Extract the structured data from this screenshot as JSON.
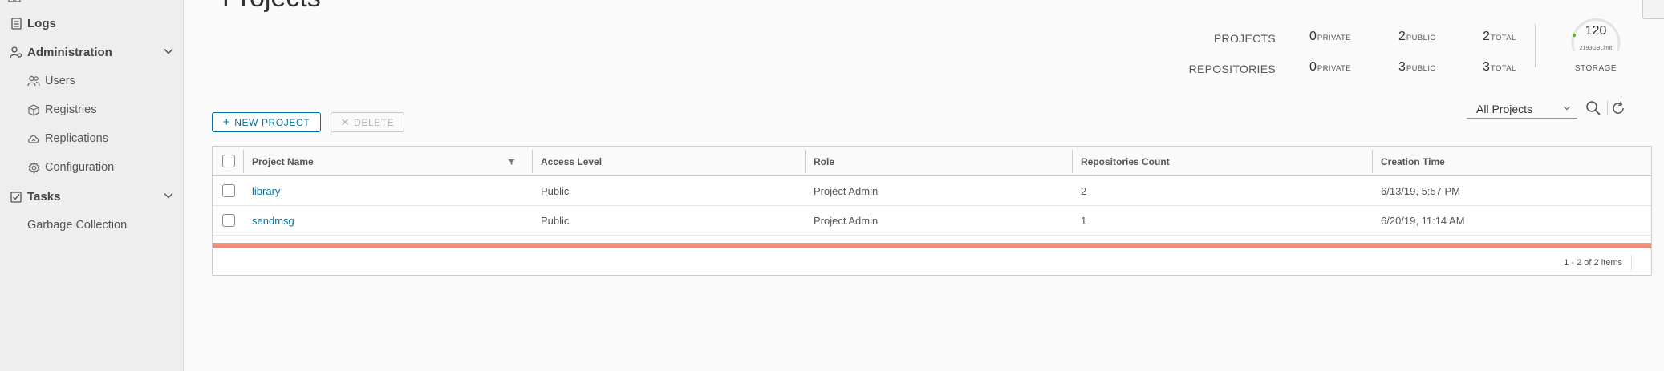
{
  "sidebar": {
    "items": [
      {
        "label": "Logs",
        "icon": "logs-icon",
        "kind": "top"
      },
      {
        "label": "Administration",
        "icon": "administration-icon",
        "kind": "top",
        "expanded": true
      },
      {
        "label": "Users",
        "icon": "users-icon",
        "kind": "sub"
      },
      {
        "label": "Registries",
        "icon": "registries-icon",
        "kind": "sub"
      },
      {
        "label": "Replications",
        "icon": "replications-icon",
        "kind": "sub"
      },
      {
        "label": "Configuration",
        "icon": "configuration-icon",
        "kind": "sub"
      },
      {
        "label": "Tasks",
        "icon": "tasks-icon",
        "kind": "top",
        "expanded": true
      },
      {
        "label": "Garbage Collection",
        "kind": "plain"
      }
    ]
  },
  "page": {
    "title": "Projects"
  },
  "stats": {
    "projects_label": "PROJECTS",
    "repositories_label": "REPOSITORIES",
    "projects": {
      "private": "0",
      "public": "2",
      "total": "2"
    },
    "repositories": {
      "private": "0",
      "public": "3",
      "total": "3"
    },
    "private_unit": "PRIVATE",
    "public_unit": "PUBLIC",
    "total_unit": "TOTAL",
    "storage": {
      "value": "120",
      "limit_text": "2193GBLimit",
      "label": "STORAGE",
      "indicator_color": "#5eb715"
    }
  },
  "toolbar": {
    "new_project_label": "NEW PROJECT",
    "delete_label": "DELETE",
    "filter_value": "All Projects"
  },
  "table": {
    "columns": [
      "Project Name",
      "Access Level",
      "Role",
      "Repositories Count",
      "Creation Time"
    ],
    "rows": [
      {
        "name": "library",
        "access": "Public",
        "role": "Project Admin",
        "repos": "2",
        "created": "6/13/19, 5:57 PM"
      },
      {
        "name": "sendmsg",
        "access": "Public",
        "role": "Project Admin",
        "repos": "1",
        "created": "6/20/19, 11:14 AM"
      }
    ],
    "footer": "1 - 2 of 2 items"
  },
  "colors": {
    "accent": "#0072a3",
    "progress_bar": "#e98a6f"
  }
}
